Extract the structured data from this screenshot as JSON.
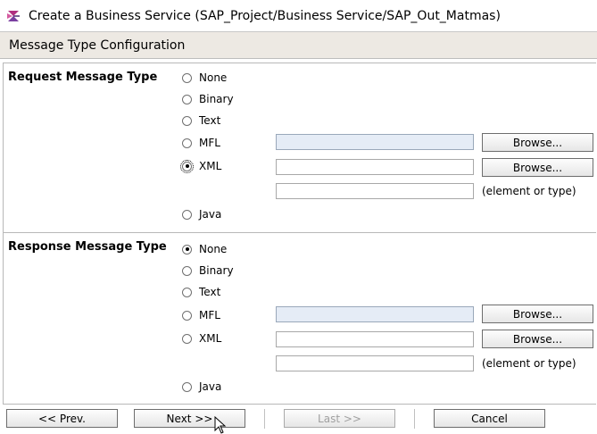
{
  "window": {
    "title": "Create a Business Service (SAP_Project/Business Service/SAP_Out_Matmas)",
    "icon": "business-service-icon"
  },
  "section": {
    "title": "Message Type Configuration"
  },
  "request": {
    "label": "Request Message Type",
    "options": {
      "none": "None",
      "binary": "Binary",
      "text": "Text",
      "mfl": "MFL",
      "xml": "XML",
      "java": "Java"
    },
    "selected": "XML",
    "browse_mfl": "Browse...",
    "browse_xml": "Browse...",
    "element_hint": "(element or type)",
    "mfl_value": "",
    "xml_value": "",
    "element_value": ""
  },
  "response": {
    "label": "Response Message Type",
    "options": {
      "none": "None",
      "binary": "Binary",
      "text": "Text",
      "mfl": "MFL",
      "xml": "XML",
      "java": "Java"
    },
    "selected": "None",
    "browse_mfl": "Browse...",
    "browse_xml": "Browse...",
    "element_hint": "(element or type)",
    "mfl_value": "",
    "xml_value": "",
    "element_value": ""
  },
  "footer": {
    "prev": "<< Prev.",
    "next": "Next >>",
    "last": "Last >>",
    "cancel": "Cancel"
  },
  "colors": {
    "header_bg": "#ede9e3",
    "shaded_field": "#e5ecf6",
    "disabled_text": "#a0a0a0"
  }
}
